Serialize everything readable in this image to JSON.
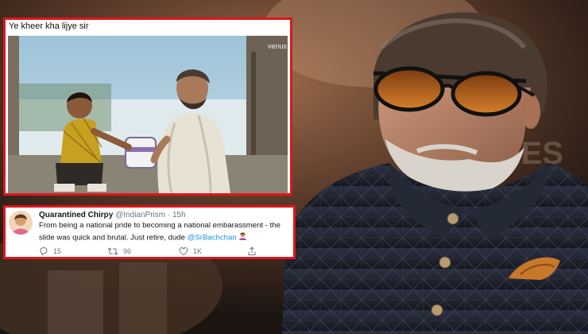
{
  "meme": {
    "caption": "Ye kheer kha lijye sir",
    "watermark": "venus"
  },
  "tweet": {
    "display_name": "Quarantined Chirpy",
    "handle": "@IndianPrism",
    "separator": "·",
    "time": "15h",
    "text": "From being a national pride to becoming a national embarassment - the slide was quick and brutal. Just retire, dude",
    "mention": "@SrBachchan",
    "reply_count": "15",
    "retweet_count": "96",
    "like_count": "1K"
  },
  "icons": {
    "reply": "reply-icon",
    "retweet": "retweet-icon",
    "like": "heart-icon",
    "share": "share-icon",
    "emoji": "woman-facepalming-emoji"
  },
  "colors": {
    "highlight_border": "#e0151b",
    "mention": "#1b95e0",
    "meta_grey": "#657786"
  }
}
